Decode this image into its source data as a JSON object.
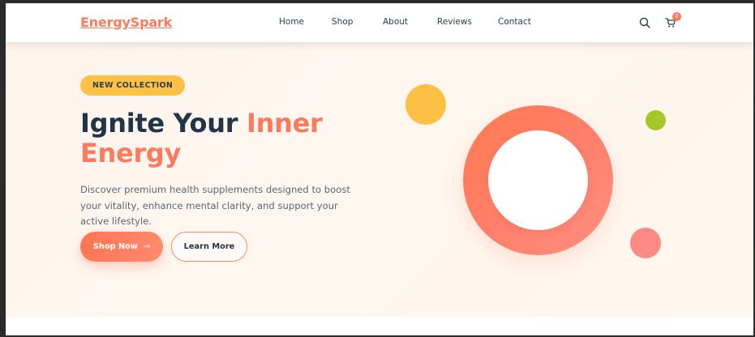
{
  "brand": {
    "logo": "EnergySpark",
    "accent_color": "#ff7a5c"
  },
  "nav": {
    "links": [
      {
        "label": "Home"
      },
      {
        "label": "Shop"
      },
      {
        "label": "About"
      },
      {
        "label": "Reviews"
      },
      {
        "label": "Contact"
      }
    ],
    "search_icon": "search-icon",
    "cart_icon": "cart-icon",
    "cart_count": "0"
  },
  "hero": {
    "badge": "NEW COLLECTION",
    "headline_part1": "Ignite Your ",
    "headline_accent": "Inner Energy",
    "description": "Discover premium health supplements designed to boost your vitality, enhance mental clarity, and support your active lifestyle.",
    "primary_button": "Shop Now",
    "primary_button_icon": "→",
    "secondary_button": "Learn More"
  },
  "colors": {
    "dark_text": "#213547",
    "badge_yellow": "#ffc145",
    "green": "#a4c72a",
    "pink": "#ff8a85"
  }
}
